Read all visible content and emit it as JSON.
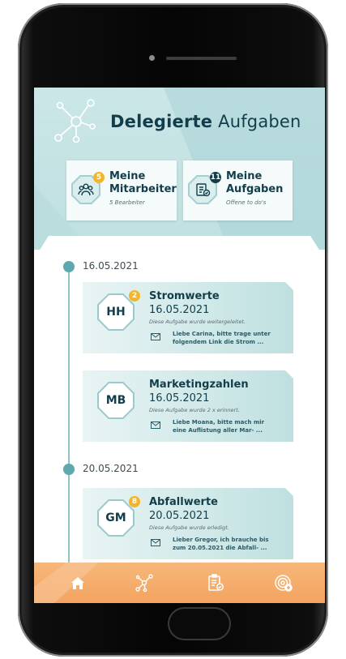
{
  "header": {
    "title_bold": "Delegierte",
    "title_light": "Aufgaben"
  },
  "cards": [
    {
      "badge": "5",
      "title_line1": "Meine",
      "title_line2": "Mitarbeiter",
      "subtitle": "5 Bearbeiter",
      "icon": "team-icon"
    },
    {
      "badge": "11",
      "title_line1": "Meine",
      "title_line2": "Aufgaben",
      "subtitle": "Offene to do's",
      "icon": "checklist-icon"
    }
  ],
  "timeline": [
    {
      "date": "16.05.2021"
    },
    {
      "date": "20.05.2021"
    }
  ],
  "tasks": [
    {
      "initials": "HH",
      "badge": "2",
      "title": "Stromwerte",
      "date": "16.05.2021",
      "note": "Diese Aufgabe wurde weitergeleitet.",
      "msg_line1": "Liebe Carina, bitte trage unter",
      "msg_line2": "folgendem Link die Strom ..."
    },
    {
      "initials": "MB",
      "badge": "",
      "title": "Marketingzahlen",
      "date": "16.05.2021",
      "note": "Diese Aufgabe wurde 2 x erinnert.",
      "msg_line1": "Liebe Moana, bitte mach mir",
      "msg_line2": "eine Auflistung aller Mar- ..."
    },
    {
      "initials": "GM",
      "badge": "8",
      "title": "Abfallwerte",
      "date": "20.05.2021",
      "note": "Diese Aufgabe wurde erledigt.",
      "msg_line1": "Lieber Gregor, ich brauche bis",
      "msg_line2": "zum 20.05.2021 die Abfall- ..."
    }
  ],
  "nav": [
    {
      "icon": "home-icon"
    },
    {
      "icon": "network-icon"
    },
    {
      "icon": "clipboard-icon"
    },
    {
      "icon": "target-add-icon"
    }
  ],
  "colors": {
    "accent": "#123e4c",
    "teal": "#5ea9ae",
    "badge_yellow": "#f3b52a",
    "nav_orange": "#f3a460"
  }
}
